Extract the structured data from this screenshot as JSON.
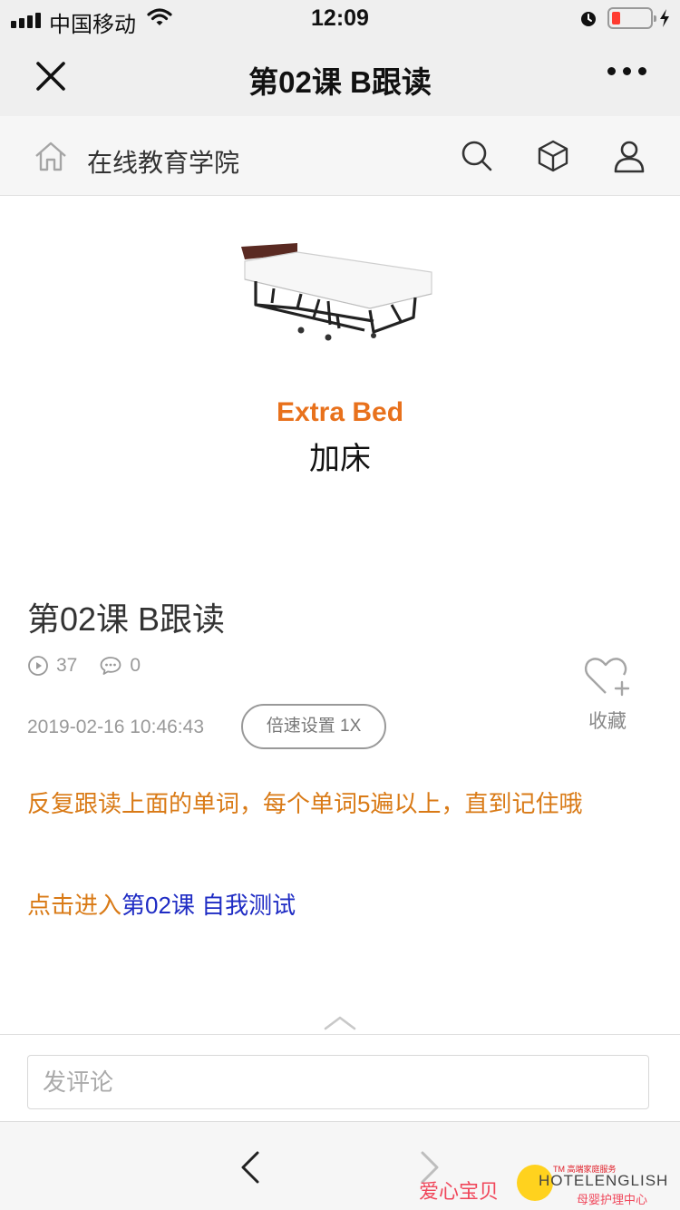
{
  "status_bar": {
    "carrier": "中国移动",
    "time": "12:09"
  },
  "nav_bar": {
    "title": "第02课 B跟读"
  },
  "site_header": {
    "site_name": "在线教育学院"
  },
  "cover": {
    "english": "Extra Bed",
    "chinese": "加床"
  },
  "article": {
    "title": "第02课 B跟读",
    "play_count": "37",
    "comment_count": "0",
    "favorite_label": "收藏",
    "date": "2019-02-16 10:46:43",
    "speed_label": "倍速设置 1X",
    "instruction": "反复跟读上面的单词，每个单词5遍以上，直到记住哦",
    "link_prefix": "点击进入",
    "link_text": "第02课 自我测试"
  },
  "comment": {
    "placeholder": "发评论"
  },
  "watermark": {
    "chinese": "爱心宝贝",
    "tm_text": "TM 高端家庭服务",
    "english": "HOTELENGLISH",
    "subtitle": "母婴护理中心"
  },
  "colors": {
    "accent_orange": "#d97a16",
    "link_blue": "#1f2cc4",
    "cover_orange": "#e8711c",
    "battery_low": "#ff3b30"
  }
}
